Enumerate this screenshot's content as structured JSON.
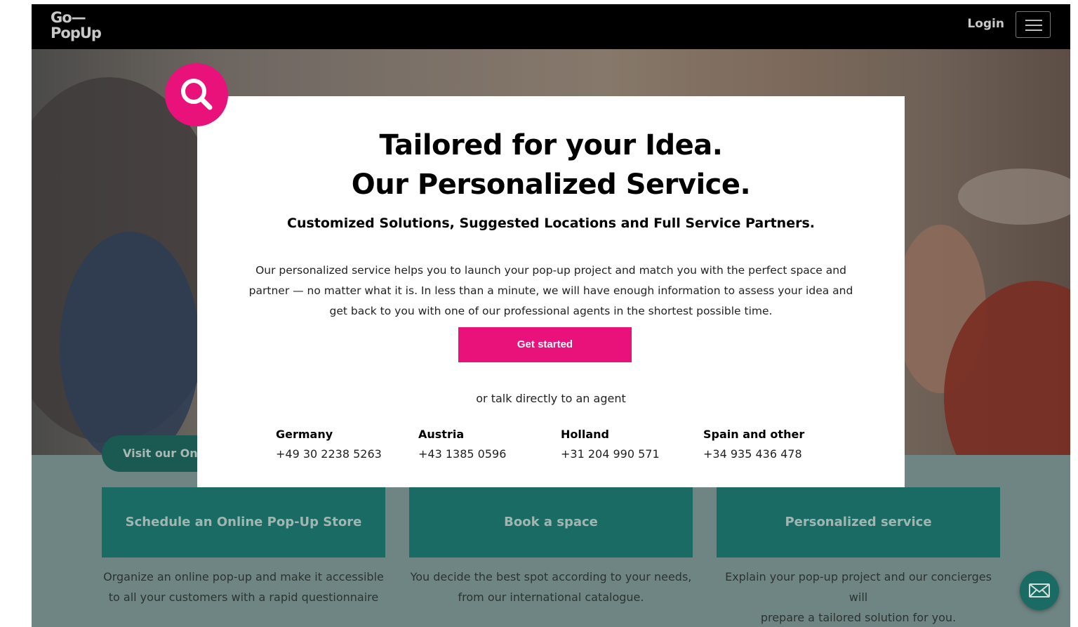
{
  "header": {
    "logo_line1": "Go—",
    "logo_line2": "PopUp",
    "login_label": "Login",
    "menu_icon": "hamburger-icon"
  },
  "modal": {
    "title_line1": "Tailored for your Idea.",
    "title_line2": "Our Personalized Service.",
    "subtitle": "Customized Solutions, Suggested Locations and Full Service Partners.",
    "description": "Our personalized service helps you to launch your pop-up project and match you with the perfect space and partner — no matter what it is. In less than a minute, we will have enough information to assess your idea and get back to you with one of our professional agents in the shortest possible time.",
    "cta_label": "Get started",
    "agent_text": "or talk directly to an agent",
    "badge_icon": "search-icon",
    "contacts": [
      {
        "country": "Germany",
        "phone": "+49 30 2238 5263"
      },
      {
        "country": "Austria",
        "phone": "+43 1385 0596"
      },
      {
        "country": "Holland",
        "phone": "+31 204 990 571"
      },
      {
        "country": "Spain and other",
        "phone": "+34 935 436 478"
      }
    ]
  },
  "background": {
    "visit_button_label": "Visit our Onl",
    "tiles": [
      {
        "label": "Schedule an Online Pop-Up Store",
        "desc_line1": "Organize an online pop-up and make it accessible",
        "desc_line2": "to all your customers with a rapid questionnaire"
      },
      {
        "label": "Book a space",
        "desc_line1": "You decide the best spot according to your needs,",
        "desc_line2": "from our international catalogue."
      },
      {
        "label": "Personalized service",
        "desc_line1": "Explain your pop-up project and our concierges will",
        "desc_line2": "prepare a tailored solution for you."
      }
    ],
    "mail_icon": "mail-icon"
  },
  "colors": {
    "accent_pink": "#e8127a",
    "teal": "#1a6b63",
    "header_bg": "#000000"
  }
}
